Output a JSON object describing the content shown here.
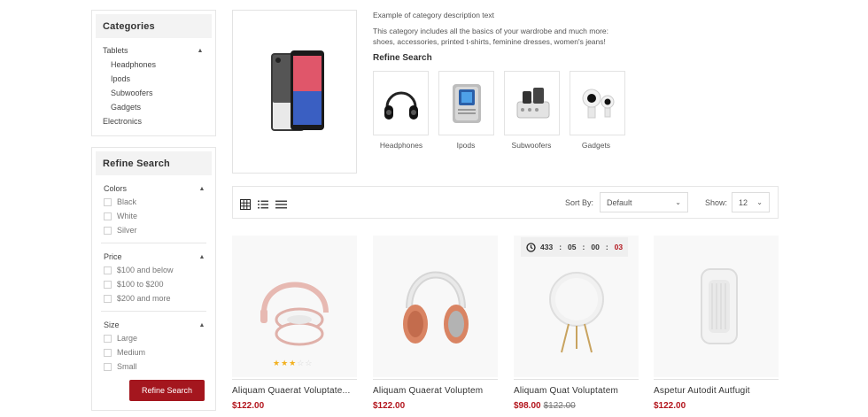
{
  "categories": {
    "title": "Categories",
    "items": [
      {
        "label": "Tablets",
        "expanded": true
      },
      {
        "label": "Headphones",
        "sub": true
      },
      {
        "label": "Ipods",
        "sub": true
      },
      {
        "label": "Subwoofers",
        "sub": true
      },
      {
        "label": "Gadgets",
        "sub": true
      },
      {
        "label": "Electronics"
      }
    ]
  },
  "refine_sidebar": {
    "title": "Refine Search",
    "groups": [
      {
        "title": "Colors",
        "options": [
          "Black",
          "White",
          "Silver"
        ]
      },
      {
        "title": "Price",
        "options": [
          "$100 and below",
          "$100 to $200",
          "$200 and more"
        ]
      },
      {
        "title": "Size",
        "options": [
          "Large",
          "Medium",
          "Small"
        ]
      }
    ],
    "button_label": "Refine Search"
  },
  "category_header": {
    "desc_title": "Example of category description text",
    "desc_line1": "This category includes all the basics of your wardrobe and much more:",
    "desc_line2": "shoes, accessories, printed t-shirts, feminine dresses, women's jeans!",
    "refine_title": "Refine Search",
    "subcategories": [
      "Headphones",
      "Ipods",
      "Subwoofers",
      "Gadgets"
    ]
  },
  "toolbar": {
    "sort_label": "Sort By:",
    "sort_value": "Default",
    "show_label": "Show:",
    "show_value": "12"
  },
  "timer": {
    "days": "433",
    "hours": "05",
    "minutes": "00",
    "seconds": "03"
  },
  "products": [
    {
      "name": "Aliquam Quaerat Voluptate...",
      "price": "$122.00",
      "rating": 3
    },
    {
      "name": "Aliquam Quaerat Voluptem",
      "price": "$122.00"
    },
    {
      "name": "Aliquam Quat Voluptatem",
      "price": "$98.00",
      "old_price": "$122.00"
    },
    {
      "name": "Aspetur Autodit Autfugit",
      "price": "$122.00"
    }
  ],
  "colors": {
    "accent": "#a4161e",
    "price": "#b3151d",
    "star": "#f2b01e"
  }
}
